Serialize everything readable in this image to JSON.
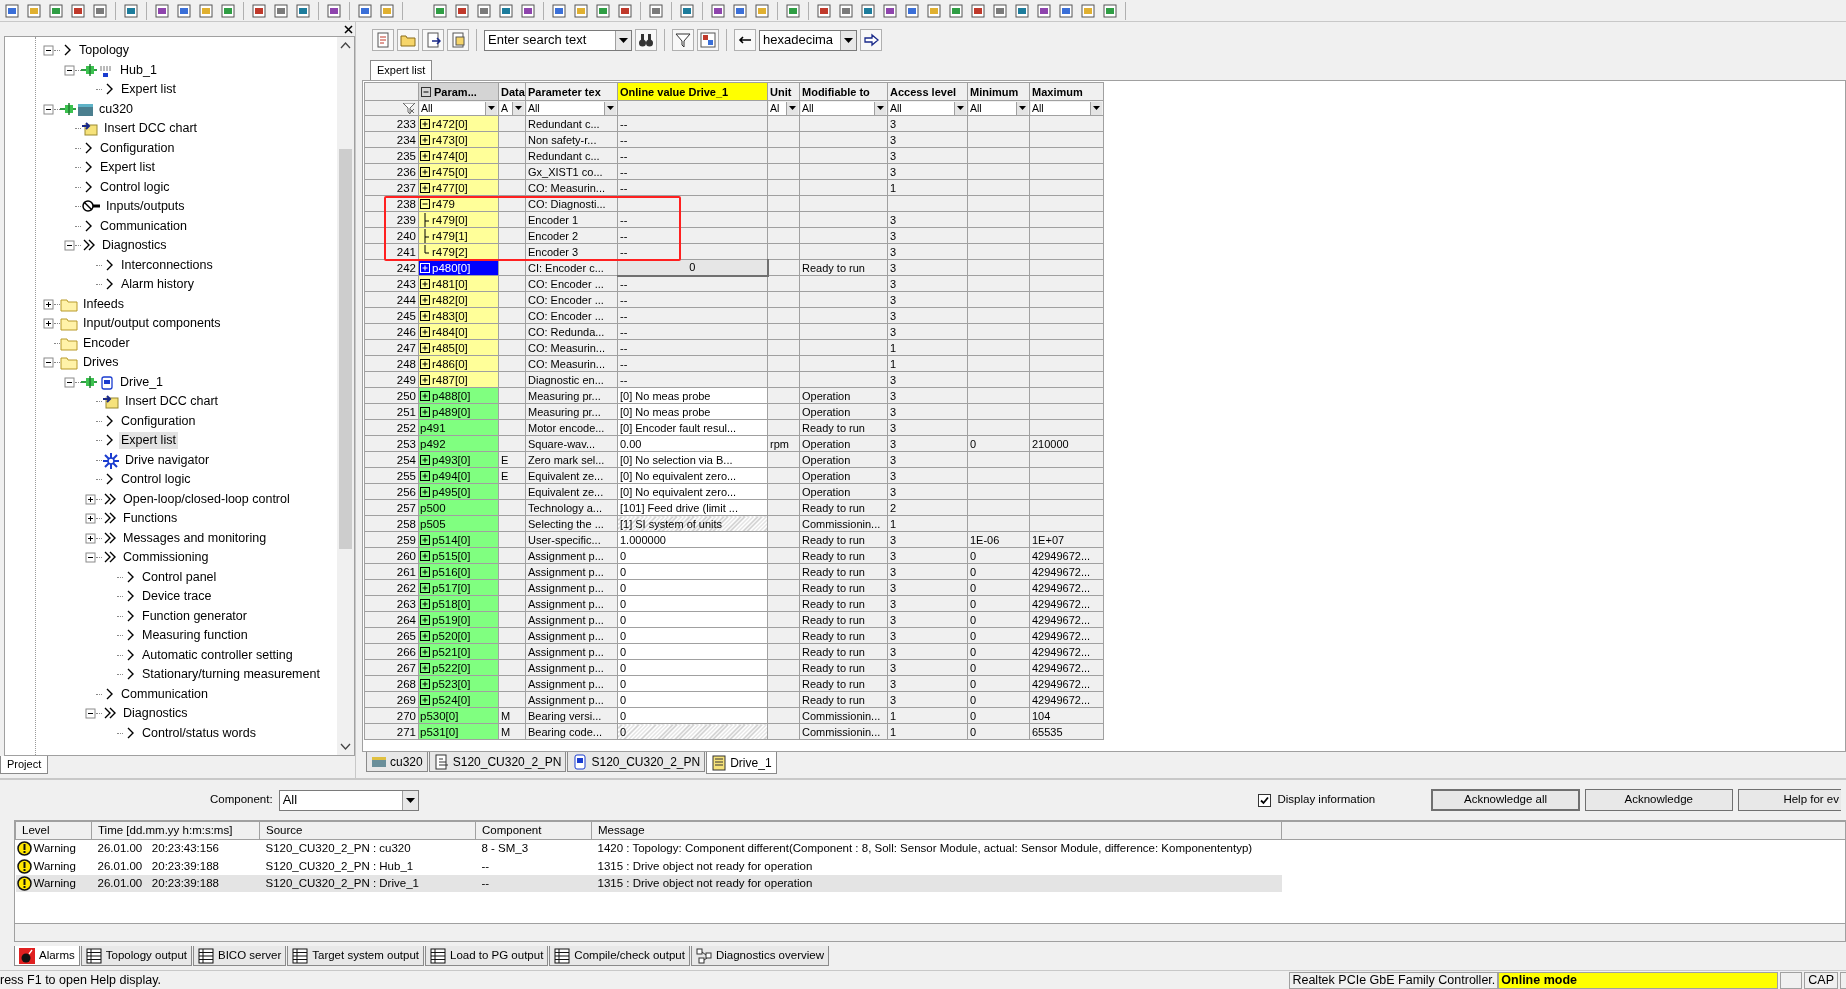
{
  "toolbar": {
    "search": {
      "value": "Enter search text"
    },
    "number_format": {
      "value": "hexadecima"
    }
  },
  "project_tree": {
    "items": [
      {
        "label": "Topology",
        "kind": "chevron",
        "expanded": true,
        "selected": false,
        "children": [
          {
            "label": "Hub_1",
            "kind": "hub",
            "expanded": true,
            "selected": false,
            "children": [
              {
                "label": "Expert list",
                "kind": "chevron",
                "selected": false
              }
            ]
          }
        ]
      },
      {
        "label": "cu320",
        "kind": "cu",
        "expanded": true,
        "selected": false,
        "children": [
          {
            "label": "Insert DCC chart",
            "kind": "dcc",
            "selected": false
          },
          {
            "label": "Configuration",
            "kind": "chevron",
            "selected": false
          },
          {
            "label": "Expert list",
            "kind": "chevron",
            "selected": false
          },
          {
            "label": "Control logic",
            "kind": "chevron",
            "selected": false
          },
          {
            "label": "Inputs/outputs",
            "kind": "io",
            "selected": false
          },
          {
            "label": "Communication",
            "kind": "chevron",
            "selected": false
          },
          {
            "label": "Diagnostics",
            "kind": "double",
            "expanded": true,
            "selected": false,
            "children": [
              {
                "label": "Interconnections",
                "kind": "chevron",
                "selected": false
              },
              {
                "label": "Alarm history",
                "kind": "chevron",
                "selected": false
              }
            ]
          }
        ]
      },
      {
        "label": "Infeeds",
        "kind": "folder",
        "expanded": false,
        "selected": false
      },
      {
        "label": "Input/output components",
        "kind": "folder",
        "expanded": false,
        "selected": false
      },
      {
        "label": "Encoder",
        "kind": "folder",
        "selected": false
      },
      {
        "label": "Drives",
        "kind": "folder",
        "expanded": true,
        "selected": false,
        "children": [
          {
            "label": "Drive_1",
            "kind": "drive",
            "expanded": true,
            "selected": false,
            "children": [
              {
                "label": "Insert DCC chart",
                "kind": "dcc",
                "selected": false
              },
              {
                "label": "Configuration",
                "kind": "chevron",
                "selected": false
              },
              {
                "label": "Expert list",
                "kind": "chevron",
                "selected": true
              },
              {
                "label": "Drive navigator",
                "kind": "navigator",
                "selected": false
              },
              {
                "label": "Control logic",
                "kind": "chevron",
                "selected": false
              },
              {
                "label": "Open-loop/closed-loop control",
                "kind": "double",
                "expanded": false,
                "selected": false
              },
              {
                "label": "Functions",
                "kind": "double",
                "expanded": false,
                "selected": false
              },
              {
                "label": "Messages and monitoring",
                "kind": "double",
                "expanded": false,
                "selected": false
              },
              {
                "label": "Commissioning",
                "kind": "double",
                "expanded": true,
                "selected": false,
                "children": [
                  {
                    "label": "Control panel",
                    "kind": "chevron",
                    "selected": false
                  },
                  {
                    "label": "Device trace",
                    "kind": "chevron",
                    "selected": false
                  },
                  {
                    "label": "Function generator",
                    "kind": "chevron",
                    "selected": false
                  },
                  {
                    "label": "Measuring function",
                    "kind": "chevron",
                    "selected": false
                  },
                  {
                    "label": "Automatic controller setting",
                    "kind": "chevron",
                    "selected": false
                  },
                  {
                    "label": "Stationary/turning measurement",
                    "kind": "chevron",
                    "selected": false
                  }
                ]
              },
              {
                "label": "Communication",
                "kind": "chevron",
                "selected": false
              },
              {
                "label": "Diagnostics",
                "kind": "double",
                "expanded": true,
                "selected": false,
                "children": [
                  {
                    "label": "Control/status words",
                    "kind": "chevron",
                    "selected": false
                  }
                ]
              }
            ]
          }
        ]
      }
    ]
  },
  "project_tab": {
    "label": "Project",
    "selected": true
  },
  "expert_list": {
    "tab": {
      "label": "Expert list",
      "selected": true
    },
    "columns": [
      {
        "label": "Param...",
        "filter": "All",
        "selected": true,
        "highlighted": false
      },
      {
        "label": "Data",
        "filter": "A",
        "selected": false,
        "highlighted": false
      },
      {
        "label": "Parameter tex",
        "filter": "All",
        "selected": false,
        "highlighted": false
      },
      {
        "label": "Online value Drive_1",
        "selected": false,
        "highlighted": true
      },
      {
        "label": "Unit",
        "filter": "Al",
        "selected": false,
        "highlighted": false
      },
      {
        "label": "Modifiable to",
        "filter": "All",
        "selected": false,
        "highlighted": false
      },
      {
        "label": "Access level",
        "filter": "All",
        "selected": false,
        "highlighted": false
      },
      {
        "label": "Minimum",
        "filter": "All",
        "selected": false,
        "highlighted": false
      },
      {
        "label": "Maximum",
        "filter": "All",
        "selected": false,
        "highlighted": false
      }
    ],
    "rows": [
      {
        "n": "233",
        "param": "r472[0]",
        "kind": "r",
        "expanded": false,
        "text": "Redundant c...",
        "online": {
          "text": "--",
          "kind": "readonly"
        },
        "access": "3",
        "selected": false,
        "highlighted": false
      },
      {
        "n": "234",
        "param": "r473[0]",
        "kind": "r",
        "expanded": false,
        "text": "Non safety-r...",
        "online": {
          "text": "--",
          "kind": "readonly"
        },
        "access": "3",
        "selected": false,
        "highlighted": false
      },
      {
        "n": "235",
        "param": "r474[0]",
        "kind": "r",
        "expanded": false,
        "text": "Redundant c...",
        "online": {
          "text": "--",
          "kind": "readonly"
        },
        "access": "3",
        "selected": false,
        "highlighted": false
      },
      {
        "n": "236",
        "param": "r475[0]",
        "kind": "r",
        "expanded": false,
        "text": "Gx_XIST1 co...",
        "online": {
          "text": "--",
          "kind": "readonly"
        },
        "access": "3",
        "selected": false,
        "highlighted": false
      },
      {
        "n": "237",
        "param": "r477[0]",
        "kind": "r",
        "expanded": false,
        "text": "CO: Measurin...",
        "online": {
          "text": "--",
          "kind": "readonly"
        },
        "access": "1",
        "selected": false,
        "highlighted": false
      },
      {
        "n": "238",
        "param": "r479",
        "kind": "r",
        "expanded": true,
        "text": "CO: Diagnosti...",
        "online": {
          "kind": "readonly"
        },
        "selected": false,
        "highlighted": true,
        "children": [
          {
            "n": "239",
            "param": "r479[0]",
            "kind": "r",
            "text": "Encoder 1",
            "online": {
              "text": "--",
              "kind": "readonly"
            },
            "access": "3",
            "selected": false
          },
          {
            "n": "240",
            "param": "r479[1]",
            "kind": "r",
            "text": "Encoder 2",
            "online": {
              "text": "--",
              "kind": "readonly"
            },
            "access": "3",
            "selected": false
          },
          {
            "n": "241",
            "param": "r479[2]",
            "kind": "r",
            "text": "Encoder 3",
            "online": {
              "text": "--",
              "kind": "readonly"
            },
            "access": "3",
            "selected": false
          }
        ]
      },
      {
        "n": "242",
        "param": "p480[0]",
        "expanded": false,
        "text": "CI: Encoder c...",
        "online": {
          "text": "0",
          "kind": "editing"
        },
        "modifiable": "Ready to run",
        "access": "3",
        "selected": true,
        "highlighted": false
      },
      {
        "n": "243",
        "param": "r481[0]",
        "kind": "r",
        "expanded": false,
        "text": "CO: Encoder ...",
        "online": {
          "text": "--",
          "kind": "readonly"
        },
        "access": "3",
        "selected": false,
        "highlighted": false
      },
      {
        "n": "244",
        "param": "r482[0]",
        "kind": "r",
        "expanded": false,
        "text": "CO: Encoder ...",
        "online": {
          "text": "--",
          "kind": "readonly"
        },
        "access": "3",
        "selected": false,
        "highlighted": false
      },
      {
        "n": "245",
        "param": "r483[0]",
        "kind": "r",
        "expanded": false,
        "text": "CO: Encoder ...",
        "online": {
          "text": "--",
          "kind": "readonly"
        },
        "access": "3",
        "selected": false,
        "highlighted": false
      },
      {
        "n": "246",
        "param": "r484[0]",
        "kind": "r",
        "expanded": false,
        "text": "CO: Redunda...",
        "online": {
          "text": "--",
          "kind": "readonly"
        },
        "access": "3",
        "selected": false,
        "highlighted": false
      },
      {
        "n": "247",
        "param": "r485[0]",
        "kind": "r",
        "expanded": false,
        "text": "CO: Measurin...",
        "online": {
          "text": "--",
          "kind": "readonly"
        },
        "access": "1",
        "selected": false,
        "highlighted": false
      },
      {
        "n": "248",
        "param": "r486[0]",
        "kind": "r",
        "expanded": false,
        "text": "CO: Measurin...",
        "online": {
          "text": "--",
          "kind": "readonly"
        },
        "access": "1",
        "selected": false,
        "highlighted": false
      },
      {
        "n": "249",
        "param": "r487[0]",
        "kind": "r",
        "expanded": false,
        "text": "Diagnostic en...",
        "online": {
          "text": "--",
          "kind": "readonly"
        },
        "access": "3",
        "selected": false,
        "highlighted": false
      },
      {
        "n": "250",
        "param": "p488[0]",
        "kind": "p",
        "expanded": false,
        "text": "Measuring pr...",
        "online": {
          "text": "[0] No meas probe",
          "kind": "editable"
        },
        "modifiable": "Operation",
        "access": "3",
        "selected": false,
        "highlighted": false
      },
      {
        "n": "251",
        "param": "p489[0]",
        "kind": "p",
        "expanded": false,
        "text": "Measuring pr...",
        "online": {
          "text": "[0] No meas probe",
          "kind": "editable"
        },
        "modifiable": "Operation",
        "access": "3",
        "selected": false,
        "highlighted": false
      },
      {
        "n": "252",
        "param": "p491",
        "kind": "p",
        "text": "Motor encode...",
        "online": {
          "text": "[0] Encoder fault resul...",
          "kind": "editable"
        },
        "modifiable": "Ready to run",
        "access": "3",
        "selected": false,
        "highlighted": false
      },
      {
        "n": "253",
        "param": "p492",
        "kind": "p",
        "text": "Square-wav...",
        "online": {
          "text": "0.00",
          "kind": "editable"
        },
        "unit": "rpm",
        "modifiable": "Operation",
        "access": "3",
        "minimum": "0",
        "maximum": "210000",
        "selected": false,
        "highlighted": false
      },
      {
        "n": "254",
        "param": "p493[0]",
        "kind": "p",
        "expanded": false,
        "data": "E",
        "text": "Zero mark sel...",
        "online": {
          "text": "[0] No selection via B...",
          "kind": "editable"
        },
        "modifiable": "Operation",
        "access": "3",
        "selected": false,
        "highlighted": false
      },
      {
        "n": "255",
        "param": "p494[0]",
        "kind": "p",
        "expanded": false,
        "data": "E",
        "text": "Equivalent ze...",
        "online": {
          "text": "[0] No equivalent zero...",
          "kind": "editable"
        },
        "modifiable": "Operation",
        "access": "3",
        "selected": false,
        "highlighted": false
      },
      {
        "n": "256",
        "param": "p495[0]",
        "kind": "p",
        "expanded": false,
        "text": "Equivalent ze...",
        "online": {
          "text": "[0] No equivalent zero...",
          "kind": "editable"
        },
        "modifiable": "Operation",
        "access": "3",
        "selected": false,
        "highlighted": false
      },
      {
        "n": "257",
        "param": "p500",
        "kind": "p",
        "text": "Technology a...",
        "online": {
          "text": "[101] Feed drive (limit ...",
          "kind": "editable"
        },
        "modifiable": "Ready to run",
        "access": "2",
        "selected": false,
        "highlighted": false
      },
      {
        "n": "258",
        "param": "p505",
        "kind": "p",
        "text": "Selecting the ...",
        "online": {
          "text": "[1] SI system of units",
          "kind": "locked"
        },
        "modifiable": "Commissionin...",
        "access": "1",
        "selected": false,
        "highlighted": false
      },
      {
        "n": "259",
        "param": "p514[0]",
        "kind": "p",
        "expanded": false,
        "text": "User-specific...",
        "online": {
          "text": "1.000000",
          "kind": "editable"
        },
        "modifiable": "Ready to run",
        "access": "3",
        "minimum": "1E-06",
        "maximum": "1E+07",
        "selected": false,
        "highlighted": false
      },
      {
        "n": "260",
        "param": "p515[0]",
        "kind": "p",
        "expanded": false,
        "text": "Assignment p...",
        "online": {
          "text": "0",
          "kind": "editable"
        },
        "modifiable": "Ready to run",
        "access": "3",
        "minimum": "0",
        "maximum": "42949672...",
        "selected": false,
        "highlighted": false
      },
      {
        "n": "261",
        "param": "p516[0]",
        "kind": "p",
        "expanded": false,
        "text": "Assignment p...",
        "online": {
          "text": "0",
          "kind": "editable"
        },
        "modifiable": "Ready to run",
        "access": "3",
        "minimum": "0",
        "maximum": "42949672...",
        "selected": false,
        "highlighted": false
      },
      {
        "n": "262",
        "param": "p517[0]",
        "kind": "p",
        "expanded": false,
        "text": "Assignment p...",
        "online": {
          "text": "0",
          "kind": "editable"
        },
        "modifiable": "Ready to run",
        "access": "3",
        "minimum": "0",
        "maximum": "42949672...",
        "selected": false,
        "highlighted": false
      },
      {
        "n": "263",
        "param": "p518[0]",
        "kind": "p",
        "expanded": false,
        "text": "Assignment p...",
        "online": {
          "text": "0",
          "kind": "editable"
        },
        "modifiable": "Ready to run",
        "access": "3",
        "minimum": "0",
        "maximum": "42949672...",
        "selected": false,
        "highlighted": false
      },
      {
        "n": "264",
        "param": "p519[0]",
        "kind": "p",
        "expanded": false,
        "text": "Assignment p...",
        "online": {
          "text": "0",
          "kind": "editable"
        },
        "modifiable": "Ready to run",
        "access": "3",
        "minimum": "0",
        "maximum": "42949672...",
        "selected": false,
        "highlighted": false
      },
      {
        "n": "265",
        "param": "p520[0]",
        "kind": "p",
        "expanded": false,
        "text": "Assignment p...",
        "online": {
          "text": "0",
          "kind": "editable"
        },
        "modifiable": "Ready to run",
        "access": "3",
        "minimum": "0",
        "maximum": "42949672...",
        "selected": false,
        "highlighted": false
      },
      {
        "n": "266",
        "param": "p521[0]",
        "kind": "p",
        "expanded": false,
        "text": "Assignment p...",
        "online": {
          "text": "0",
          "kind": "editable"
        },
        "modifiable": "Ready to run",
        "access": "3",
        "minimum": "0",
        "maximum": "42949672...",
        "selected": false,
        "highlighted": false
      },
      {
        "n": "267",
        "param": "p522[0]",
        "kind": "p",
        "expanded": false,
        "text": "Assignment p...",
        "online": {
          "text": "0",
          "kind": "editable"
        },
        "modifiable": "Ready to run",
        "access": "3",
        "minimum": "0",
        "maximum": "42949672...",
        "selected": false,
        "highlighted": false
      },
      {
        "n": "268",
        "param": "p523[0]",
        "kind": "p",
        "expanded": false,
        "text": "Assignment p...",
        "online": {
          "text": "0",
          "kind": "editable"
        },
        "modifiable": "Ready to run",
        "access": "3",
        "minimum": "0",
        "maximum": "42949672...",
        "selected": false,
        "highlighted": false
      },
      {
        "n": "269",
        "param": "p524[0]",
        "kind": "p",
        "expanded": false,
        "text": "Assignment p...",
        "online": {
          "text": "0",
          "kind": "editable"
        },
        "modifiable": "Ready to run",
        "access": "3",
        "minimum": "0",
        "maximum": "42949672...",
        "selected": false,
        "highlighted": false
      },
      {
        "n": "270",
        "param": "p530[0]",
        "kind": "p",
        "data": "M",
        "text": "Bearing versi...",
        "online": {
          "text": "0",
          "kind": "editable"
        },
        "modifiable": "Commissionin...",
        "access": "1",
        "minimum": "0",
        "maximum": "104",
        "selected": false,
        "highlighted": false
      },
      {
        "n": "271",
        "param": "p531[0]",
        "kind": "p",
        "data": "M",
        "text": "Bearing code...",
        "online": {
          "text": "0",
          "kind": "locked"
        },
        "modifiable": "Commissionin...",
        "access": "1",
        "minimum": "0",
        "maximum": "65535",
        "selected": false,
        "highlighted": false
      }
    ]
  },
  "document_tabs": [
    {
      "label": "cu320",
      "kind": "cu",
      "selected": false
    },
    {
      "label": "S120_CU320_2_PN",
      "kind": "topology",
      "selected": false
    },
    {
      "label": "S120_CU320_2_PN",
      "kind": "drive",
      "selected": false
    },
    {
      "label": "Drive_1",
      "kind": "list",
      "selected": true
    }
  ],
  "alarms": {
    "component": {
      "label": "Component:",
      "value": "All"
    },
    "display_information": {
      "label": "Display information",
      "checked": true
    },
    "buttons": [
      "Acknowledge all",
      "Acknowledge",
      "Help for ev"
    ],
    "columns": [
      "Level",
      "Time [dd.mm.yy  h:m:s:ms]",
      "Source",
      "Component",
      "Message"
    ],
    "rows": [
      {
        "level": "Warning",
        "time": "26.01.00   20:23:43:156",
        "source": "S120_CU320_2_PN : cu320",
        "component": "8 - SM_3",
        "message": "1420 : Topology: Component different(Component : 8, Soll: Sensor Module, actual: Sensor Module, difference: Komponententyp)",
        "selected": false
      },
      {
        "level": "Warning",
        "time": "26.01.00   20:23:39:188",
        "source": "S120_CU320_2_PN : Hub_1",
        "component": "--",
        "message": "1315 : Drive object not ready for operation",
        "selected": false
      },
      {
        "level": "Warning",
        "time": "26.01.00   20:23:39:188",
        "source": "S120_CU320_2_PN : Drive_1",
        "component": "--",
        "message": "1315 : Drive object not ready for operation",
        "selected": true
      }
    ],
    "tabs": [
      {
        "label": "Alarms",
        "kind": "alarm",
        "selected": true
      },
      {
        "label": "Topology output",
        "kind": "table",
        "selected": false
      },
      {
        "label": "BICO server",
        "kind": "table",
        "selected": false
      },
      {
        "label": "Target system output",
        "kind": "table",
        "selected": false
      },
      {
        "label": "Load to PG output",
        "kind": "table",
        "selected": false
      },
      {
        "label": "Compile/check output",
        "kind": "table",
        "selected": false
      },
      {
        "label": "Diagnostics overview",
        "kind": "network",
        "selected": false
      }
    ]
  },
  "status_bar": {
    "hint": "ress F1 to open Help display.",
    "adapter": "Realtek PCIe GbE Family Controller.",
    "mode": "Online mode",
    "caps": "CAP"
  }
}
